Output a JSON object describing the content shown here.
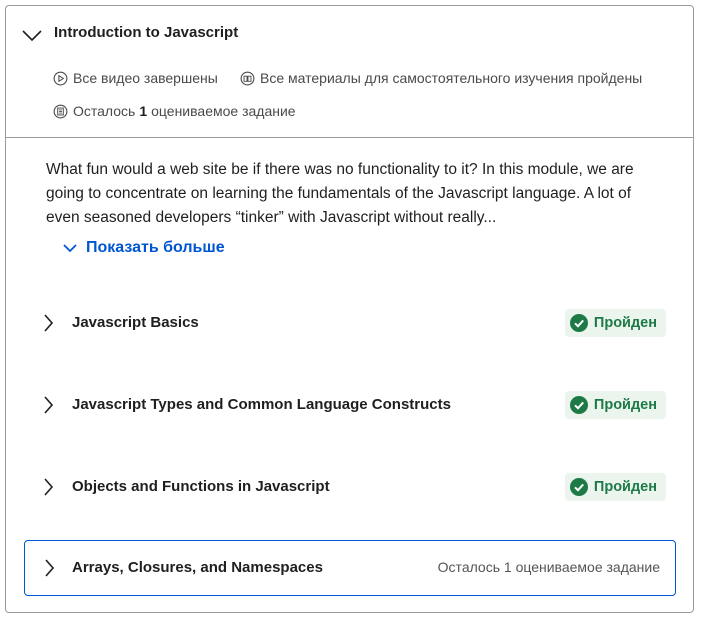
{
  "module": {
    "title": "Introduction to Javascript",
    "meta": {
      "videos": "Все видео завершены",
      "readings": "Все материалы для самостоятельного изучения пройдены",
      "remaining_prefix": "Осталось",
      "remaining_count": "1",
      "remaining_suffix": "оцениваемое задание"
    },
    "description": "What fun would a web site be if there was no functionality to it? In this module, we are going to concentrate on learning the fundamentals of the Javascript language. A lot of even seasoned developers “tinker” with Javascript without really...",
    "show_more": "Показать больше"
  },
  "lessons": [
    {
      "title": "Javascript Basics",
      "status": "Пройден"
    },
    {
      "title": "Javascript Types and Common Language Constructs",
      "status": "Пройден"
    },
    {
      "title": "Objects and Functions in Javascript",
      "status": "Пройден"
    },
    {
      "title": "Arrays, Closures, and Namespaces",
      "remaining": "Осталось 1 оцениваемое задание"
    }
  ],
  "colors": {
    "accent": "#0056d2",
    "success": "#1d7a47",
    "success_bg": "#ebf5ee",
    "border": "#9a9a9a"
  },
  "icons": [
    "chevron-down-icon",
    "play-circle-icon",
    "book-icon",
    "assignment-icon",
    "chevron-right-icon",
    "check-circle-icon"
  ]
}
